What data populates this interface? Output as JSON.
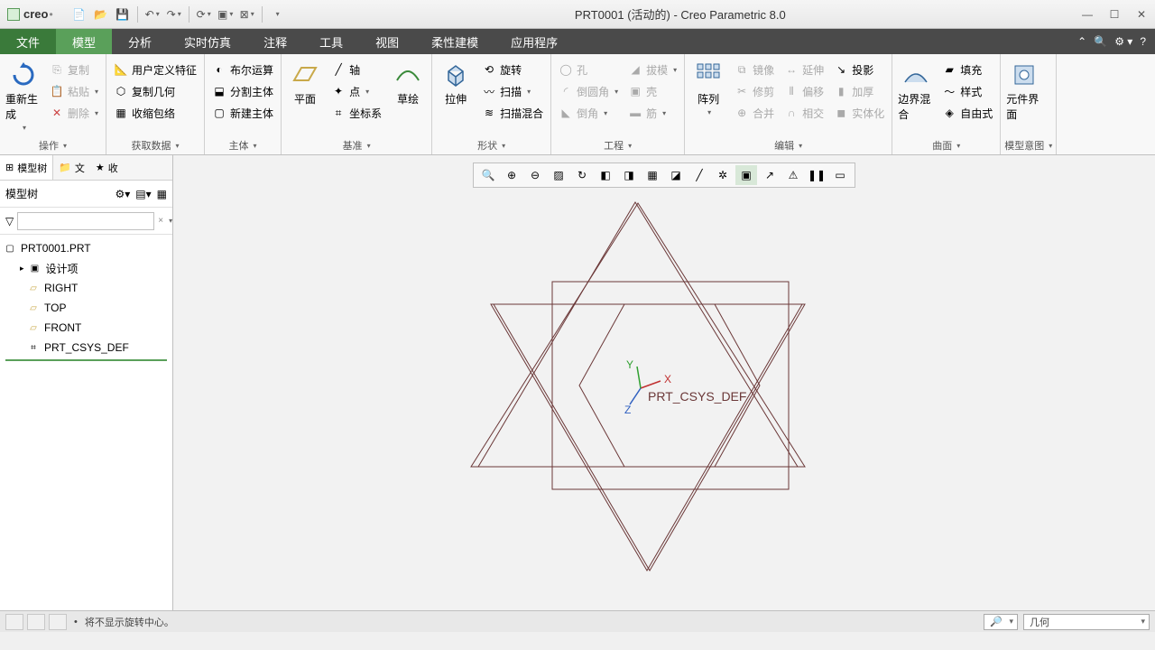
{
  "app": {
    "logo": "creo",
    "title": "PRT0001 (活动的) - Creo Parametric 8.0"
  },
  "tabs": {
    "file": "文件",
    "items": [
      "模型",
      "分析",
      "实时仿真",
      "注释",
      "工具",
      "视图",
      "柔性建模",
      "应用程序"
    ],
    "active": 0
  },
  "ribbon": {
    "g0": {
      "regen": "重新生成",
      "copy": "复制",
      "paste": "粘贴",
      "delete": "删除",
      "label": "操作"
    },
    "g1": {
      "udf": "用户定义特征",
      "copygeom": "复制几何",
      "shrink": "收缩包络",
      "label": "获取数据"
    },
    "g2": {
      "bool": "布尔运算",
      "split": "分割主体",
      "newbody": "新建主体",
      "label": "主体"
    },
    "g3": {
      "plane": "平面",
      "sketch": "草绘",
      "axis": "轴",
      "point": "点",
      "csys": "坐标系",
      "label": "基准"
    },
    "g4": {
      "extrude": "拉伸",
      "revolve": "旋转",
      "sweep": "扫描",
      "sweepblend": "扫描混合",
      "label": "形状"
    },
    "g5": {
      "hole": "孔",
      "round": "倒圆角",
      "chamfer": "倒角",
      "draft": "拔模",
      "shell": "壳",
      "rib": "筋",
      "label": "工程"
    },
    "g6": {
      "pattern": "阵列",
      "mirror": "镜像",
      "trim": "修剪",
      "merge": "合并",
      "extend": "延伸",
      "offset": "偏移",
      "intersect": "相交",
      "thicken": "加厚",
      "solidify": "实体化",
      "project": "投影",
      "label": "编辑"
    },
    "g7": {
      "bblend": "边界混合",
      "fill": "填充",
      "style": "样式",
      "freeform": "自由式",
      "label": "曲面"
    },
    "g8": {
      "compui": "元件界面",
      "label": "模型意图"
    }
  },
  "tree": {
    "tabs": [
      "模型树",
      "文",
      "收"
    ],
    "header": "模型树",
    "root": "PRT0001.PRT",
    "items": [
      "设计项",
      "RIGHT",
      "TOP",
      "FRONT",
      "PRT_CSYS_DEF"
    ]
  },
  "viewport": {
    "csys_label": "PRT_CSYS_DEF",
    "x": "X",
    "y": "Y",
    "z": "Z"
  },
  "status": {
    "msg": "将不显示旋转中心。",
    "combo": "几何"
  }
}
